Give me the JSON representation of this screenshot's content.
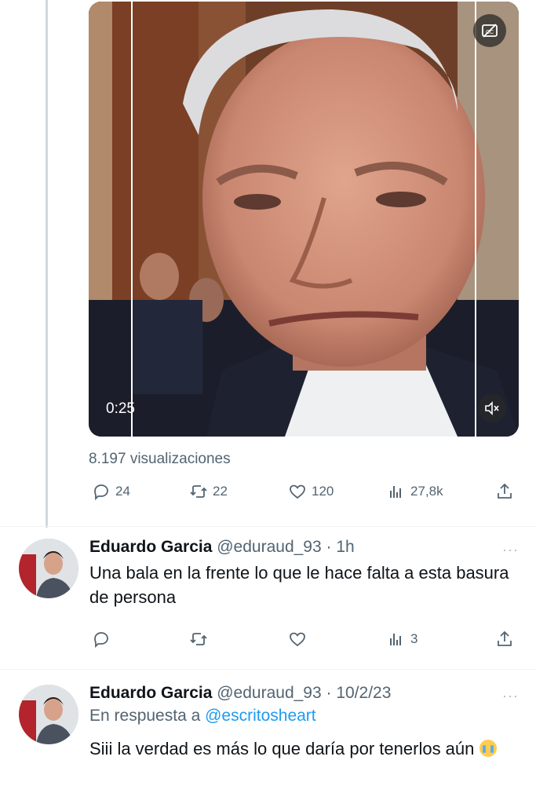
{
  "tweet": {
    "video": {
      "duration": "0:25",
      "captions_icon": "captions-icon",
      "mute_icon": "speaker-muted-icon"
    },
    "views": "8.197 visualizaciones",
    "actions": {
      "replies": "24",
      "retweets": "22",
      "likes": "120",
      "analytics": "27,8k"
    }
  },
  "replies": [
    {
      "name": "Eduardo Garcia",
      "handle_time": "@eduraud_93 · 1h",
      "more": "···",
      "text": "Una bala en la frente lo que le hace falta a esta basura de persona",
      "actions": {
        "replies": "",
        "retweets": "",
        "likes": "",
        "analytics": "3"
      }
    },
    {
      "name": "Eduardo Garcia",
      "handle_time": "@eduraud_93 · 10/2/23",
      "more": "···",
      "reply_to_prefix": "En respuesta a ",
      "reply_to_user": "@escritosheart",
      "text": "Siii la verdad es más lo que daría por tenerlos aún"
    }
  ],
  "colors": {
    "muted": "#536471",
    "link": "#1d9bf0",
    "divider": "#eff3f4"
  }
}
